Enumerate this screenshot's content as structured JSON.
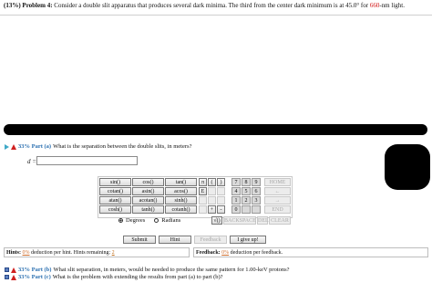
{
  "problem": {
    "label": "(13%)  Problem 4:",
    "text_before": "Consider a double slit apparatus that produces several dark minima. The third from the center dark minimum is at 45.0° for ",
    "wavelength": "660",
    "text_after": "-nm light."
  },
  "part_a": {
    "percent_label": "33% Part (a)",
    "question": "What is the separation between the double slits, in meters?"
  },
  "answer": {
    "var_label": "d =",
    "value": ""
  },
  "calculator": {
    "funcs": [
      [
        "sin()",
        "cos()",
        "tan()"
      ],
      [
        "cotan()",
        "asin()",
        "acos()"
      ],
      [
        "atan()",
        "acotan()",
        "sinh()"
      ],
      [
        "cosh()",
        "tanh()",
        "cotanh()"
      ]
    ],
    "syms": [
      [
        "π",
        "(",
        ")"
      ],
      [
        "E",
        "",
        ""
      ],
      [
        "",
        "",
        ""
      ],
      [
        "",
        "+",
        "-"
      ]
    ],
    "digits": [
      [
        "7",
        "8",
        "9"
      ],
      [
        "4",
        "5",
        "6"
      ],
      [
        "1",
        "2",
        "3"
      ],
      [
        "0",
        "",
        ""
      ]
    ],
    "right": [
      "HOME",
      "←",
      "→",
      "END"
    ],
    "bottom": [
      "√()",
      "BACKSPACE",
      "DEL",
      "CLEAR"
    ],
    "mode_degrees": "Degrees",
    "mode_radians": "Radians"
  },
  "actions": {
    "submit": "Submit",
    "hint": "Hint",
    "feedback": "Feedback",
    "give_up": "I give up!"
  },
  "hints": {
    "label": "Hints:",
    "pct": "0%",
    "text": "deduction per hint. Hints remaining:",
    "remaining": "2"
  },
  "feedback": {
    "label": "Feedback:",
    "pct": "0%",
    "text": "deduction per feedback."
  },
  "part_b": {
    "percent_label": "33% Part (b)",
    "question": "What slit separation, in meters, would be needed to produce the same pattern for 1.00-keV protons?"
  },
  "part_c": {
    "percent_label": "33% Part (c)",
    "question": "What is the problem with extending the results from part (a) to part (b)?"
  },
  "colors": {
    "accent_blue": "#2a6fb0",
    "warn_red": "#d02020",
    "highlight_red": "#d01010"
  }
}
